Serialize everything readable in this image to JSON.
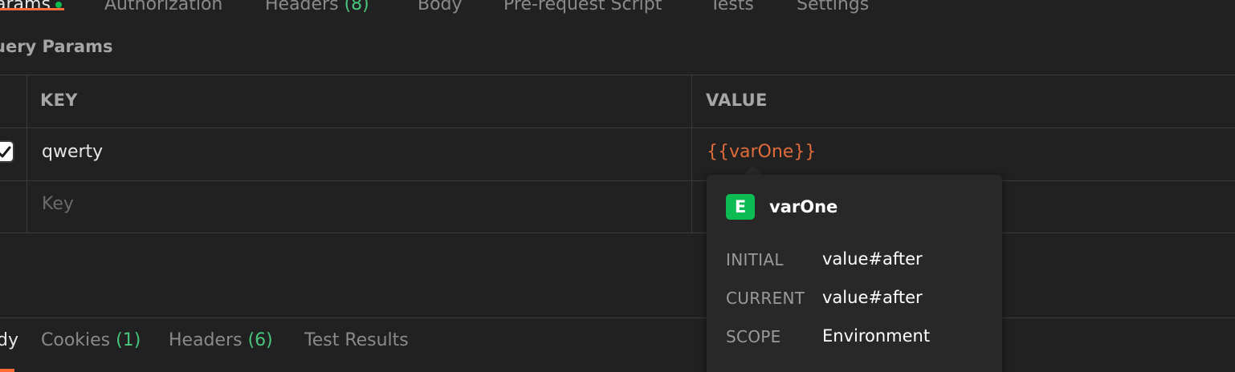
{
  "request_tabs": [
    {
      "label": "arams",
      "active": true,
      "indicator": "green-dot"
    },
    {
      "label": "Authorization",
      "active": false
    },
    {
      "label": "Headers",
      "count": "(8)",
      "active": false
    },
    {
      "label": "Body",
      "active": false
    },
    {
      "label": "Pre-request Script",
      "active": false
    },
    {
      "label": "Tests",
      "active": false
    },
    {
      "label": "Settings",
      "active": false
    }
  ],
  "section_title": "uery Params",
  "table": {
    "headers": {
      "key": "KEY",
      "value": "VALUE"
    },
    "rows": [
      {
        "checked": true,
        "key": "qwerty",
        "value": "{{varOne}}"
      }
    ],
    "empty_row": {
      "key_placeholder": "Key"
    }
  },
  "response_tabs": [
    {
      "label": "dy",
      "active": true
    },
    {
      "label": "Cookies",
      "count": "(1)",
      "active": false
    },
    {
      "label": "Headers",
      "count": "(6)",
      "active": false
    },
    {
      "label": "Test Results",
      "active": false
    }
  ],
  "tooltip": {
    "badge": "E",
    "name": "varOne",
    "fields": [
      {
        "label": "INITIAL",
        "value": "value#after"
      },
      {
        "label": "CURRENT",
        "value": "value#after"
      },
      {
        "label": "SCOPE",
        "value": "Environment"
      }
    ]
  },
  "colors": {
    "background": "#212121",
    "accent": "#ff6c37",
    "variable": "#e06c3b",
    "env_badge": "#0cbb52",
    "count_green": "#48c47c"
  }
}
